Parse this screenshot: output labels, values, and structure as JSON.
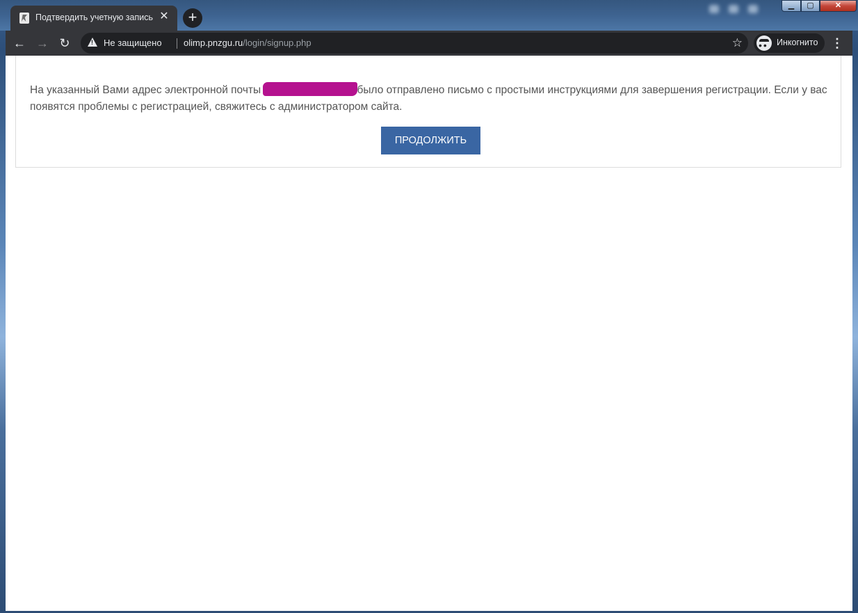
{
  "browser": {
    "tab": {
      "title": "Подтвердить учетную запись",
      "close": "✕"
    },
    "new_tab": "+",
    "window_buttons": {
      "minimize": "▁",
      "maximize": "▢",
      "close": "✕"
    },
    "nav": {
      "back": "←",
      "forward": "→",
      "reload": "↻"
    },
    "omnibox": {
      "security_label": "Не защищено",
      "url_host": "olimp.pnzgu.ru",
      "url_path": "/login/signup.php",
      "bookmark_icon": "star-icon"
    },
    "incognito_label": "Инкогнито",
    "menu": "⋮"
  },
  "page": {
    "message_before": "На указанный Вами адрес электронной почты ",
    "message_after": "было отправлено письмо с простыми инструкциями для завершения регистрации. Если у вас появятся проблемы с регистрацией, свяжитесь с администратором сайта.",
    "continue_button": "ПРОДОЛЖИТЬ"
  },
  "colors": {
    "button_bg": "#3a66a3",
    "redaction": "#b5128f",
    "text": "#555555"
  }
}
